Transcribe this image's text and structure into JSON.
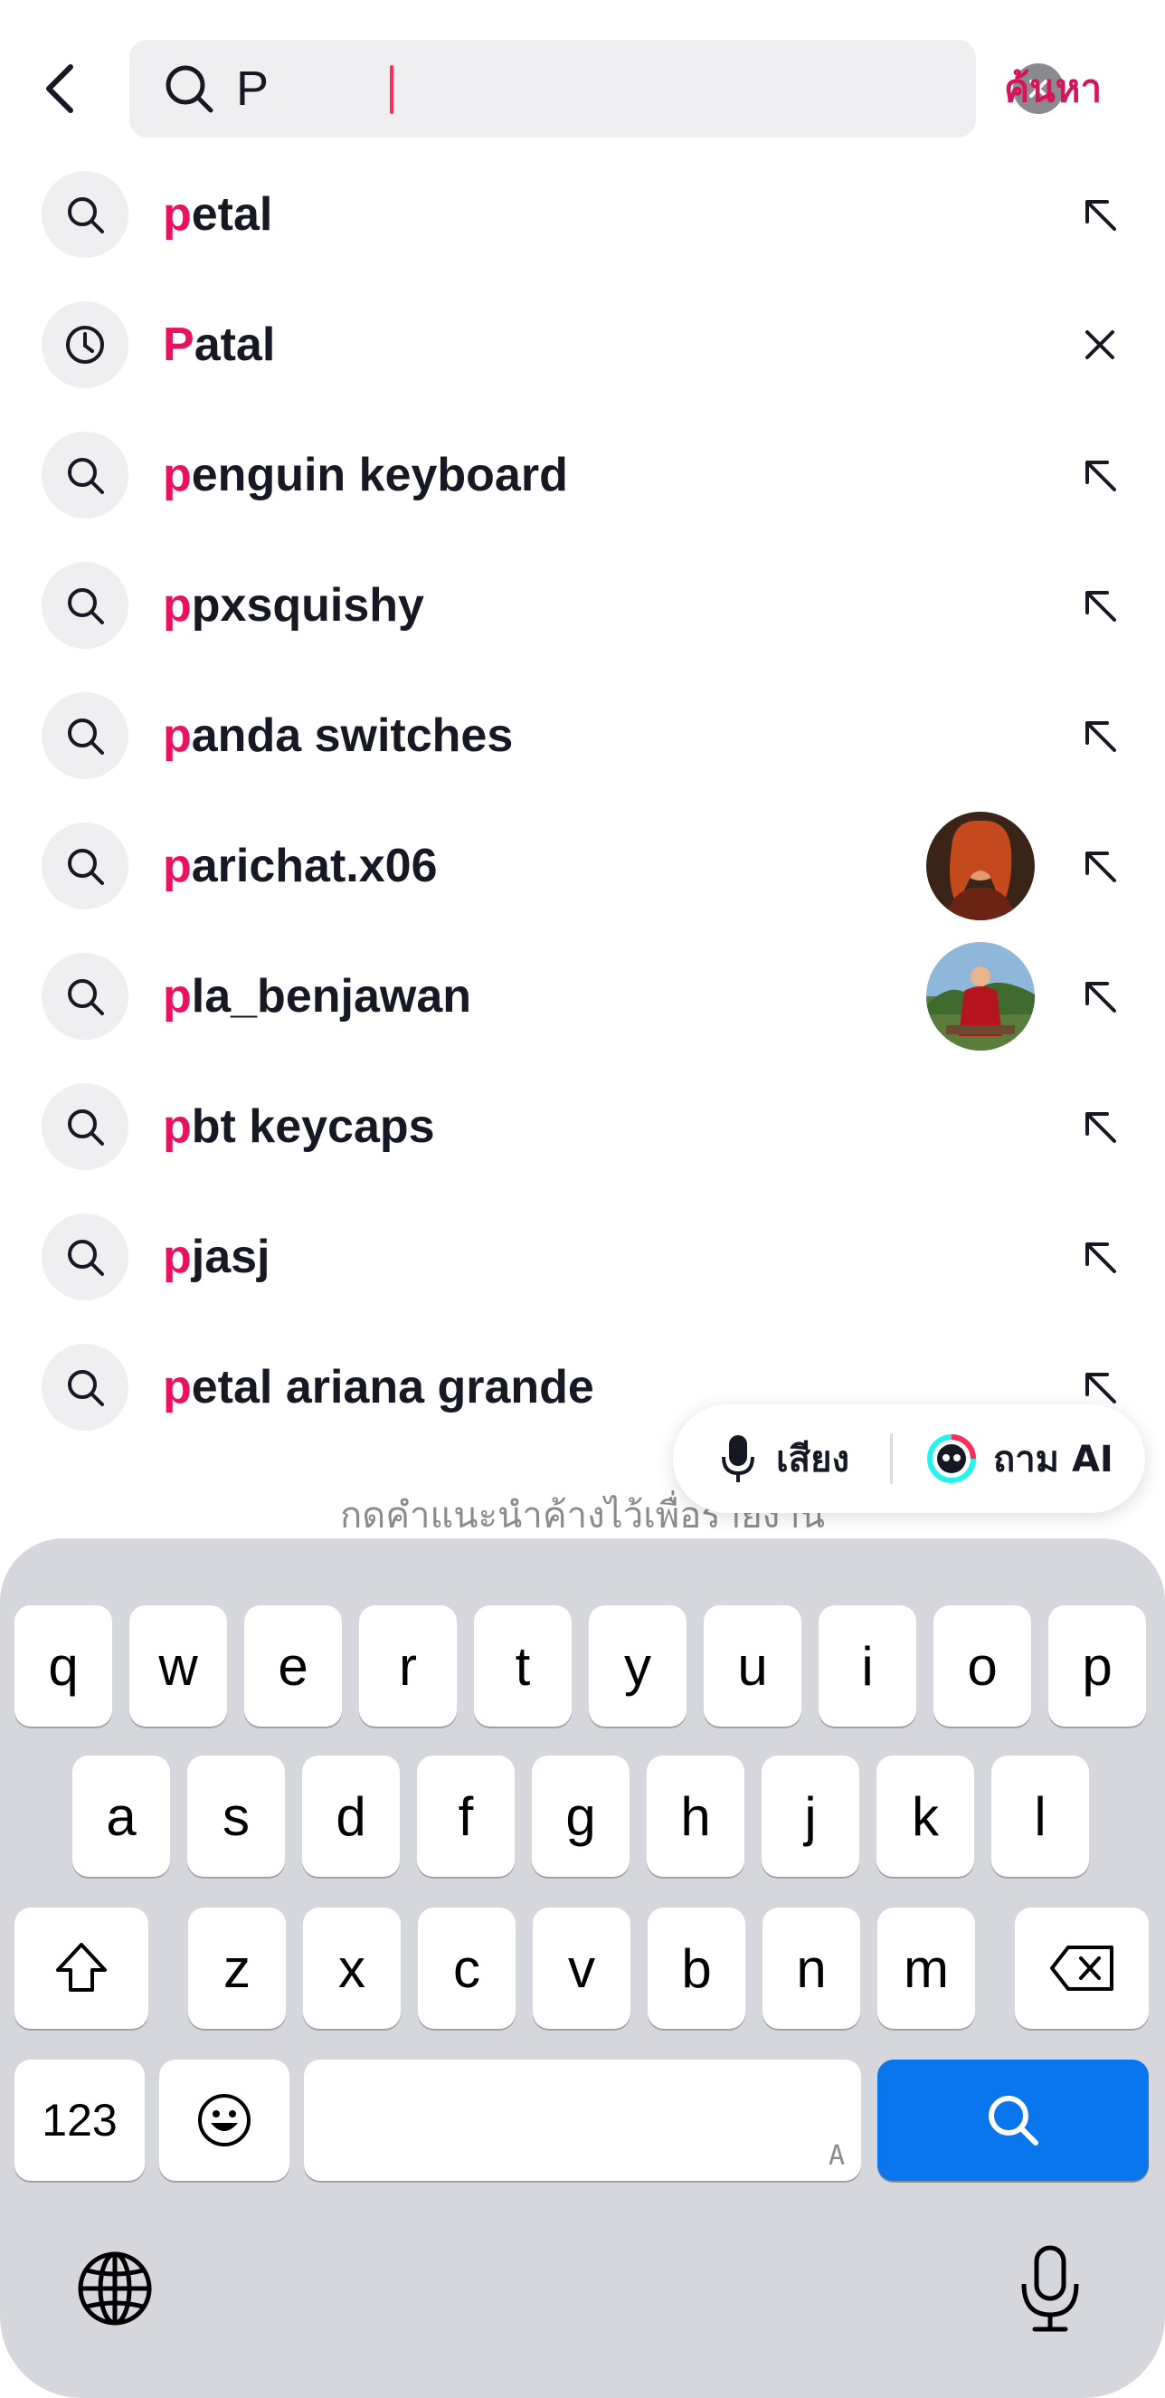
{
  "header": {
    "query": "P",
    "search_button": "ค้นหา"
  },
  "suggestions": [
    {
      "highlight": "p",
      "rest": "etal",
      "type": "search",
      "action": "fill",
      "avatar": null
    },
    {
      "highlight": "P",
      "rest": "atal",
      "type": "history",
      "action": "remove",
      "avatar": null
    },
    {
      "highlight": "p",
      "rest": "enguin keyboard",
      "type": "search",
      "action": "fill",
      "avatar": null
    },
    {
      "highlight": "p",
      "rest": "pxsquishy",
      "type": "search",
      "action": "fill",
      "avatar": null
    },
    {
      "highlight": "p",
      "rest": "anda switches",
      "type": "search",
      "action": "fill",
      "avatar": null
    },
    {
      "highlight": "p",
      "rest": "arichat.x06",
      "type": "search",
      "action": "fill",
      "avatar": "user-avatar-1"
    },
    {
      "highlight": "p",
      "rest": "la_benjawan",
      "type": "search",
      "action": "fill",
      "avatar": "user-avatar-2"
    },
    {
      "highlight": "p",
      "rest": "bt keycaps",
      "type": "search",
      "action": "fill",
      "avatar": null
    },
    {
      "highlight": "p",
      "rest": "jasj",
      "type": "search",
      "action": "fill",
      "avatar": null
    },
    {
      "highlight": "p",
      "rest": "etal ariana grande",
      "type": "search",
      "action": "fill",
      "avatar": null
    }
  ],
  "hint": "กดคำแนะนำค้างไว้เพื่อรายงาน",
  "pill": {
    "voice_label": "เสียง",
    "ai_label": "ถาม AI"
  },
  "keyboard": {
    "row1": [
      "q",
      "w",
      "e",
      "r",
      "t",
      "y",
      "u",
      "i",
      "o",
      "p"
    ],
    "row2": [
      "a",
      "s",
      "d",
      "f",
      "g",
      "h",
      "j",
      "k",
      "l"
    ],
    "row3": [
      "z",
      "x",
      "c",
      "v",
      "b",
      "n",
      "m"
    ],
    "numbers_label": "123",
    "space_mark": "A"
  },
  "colors": {
    "accent": "#e8125e",
    "search_key": "#0a76ee"
  }
}
